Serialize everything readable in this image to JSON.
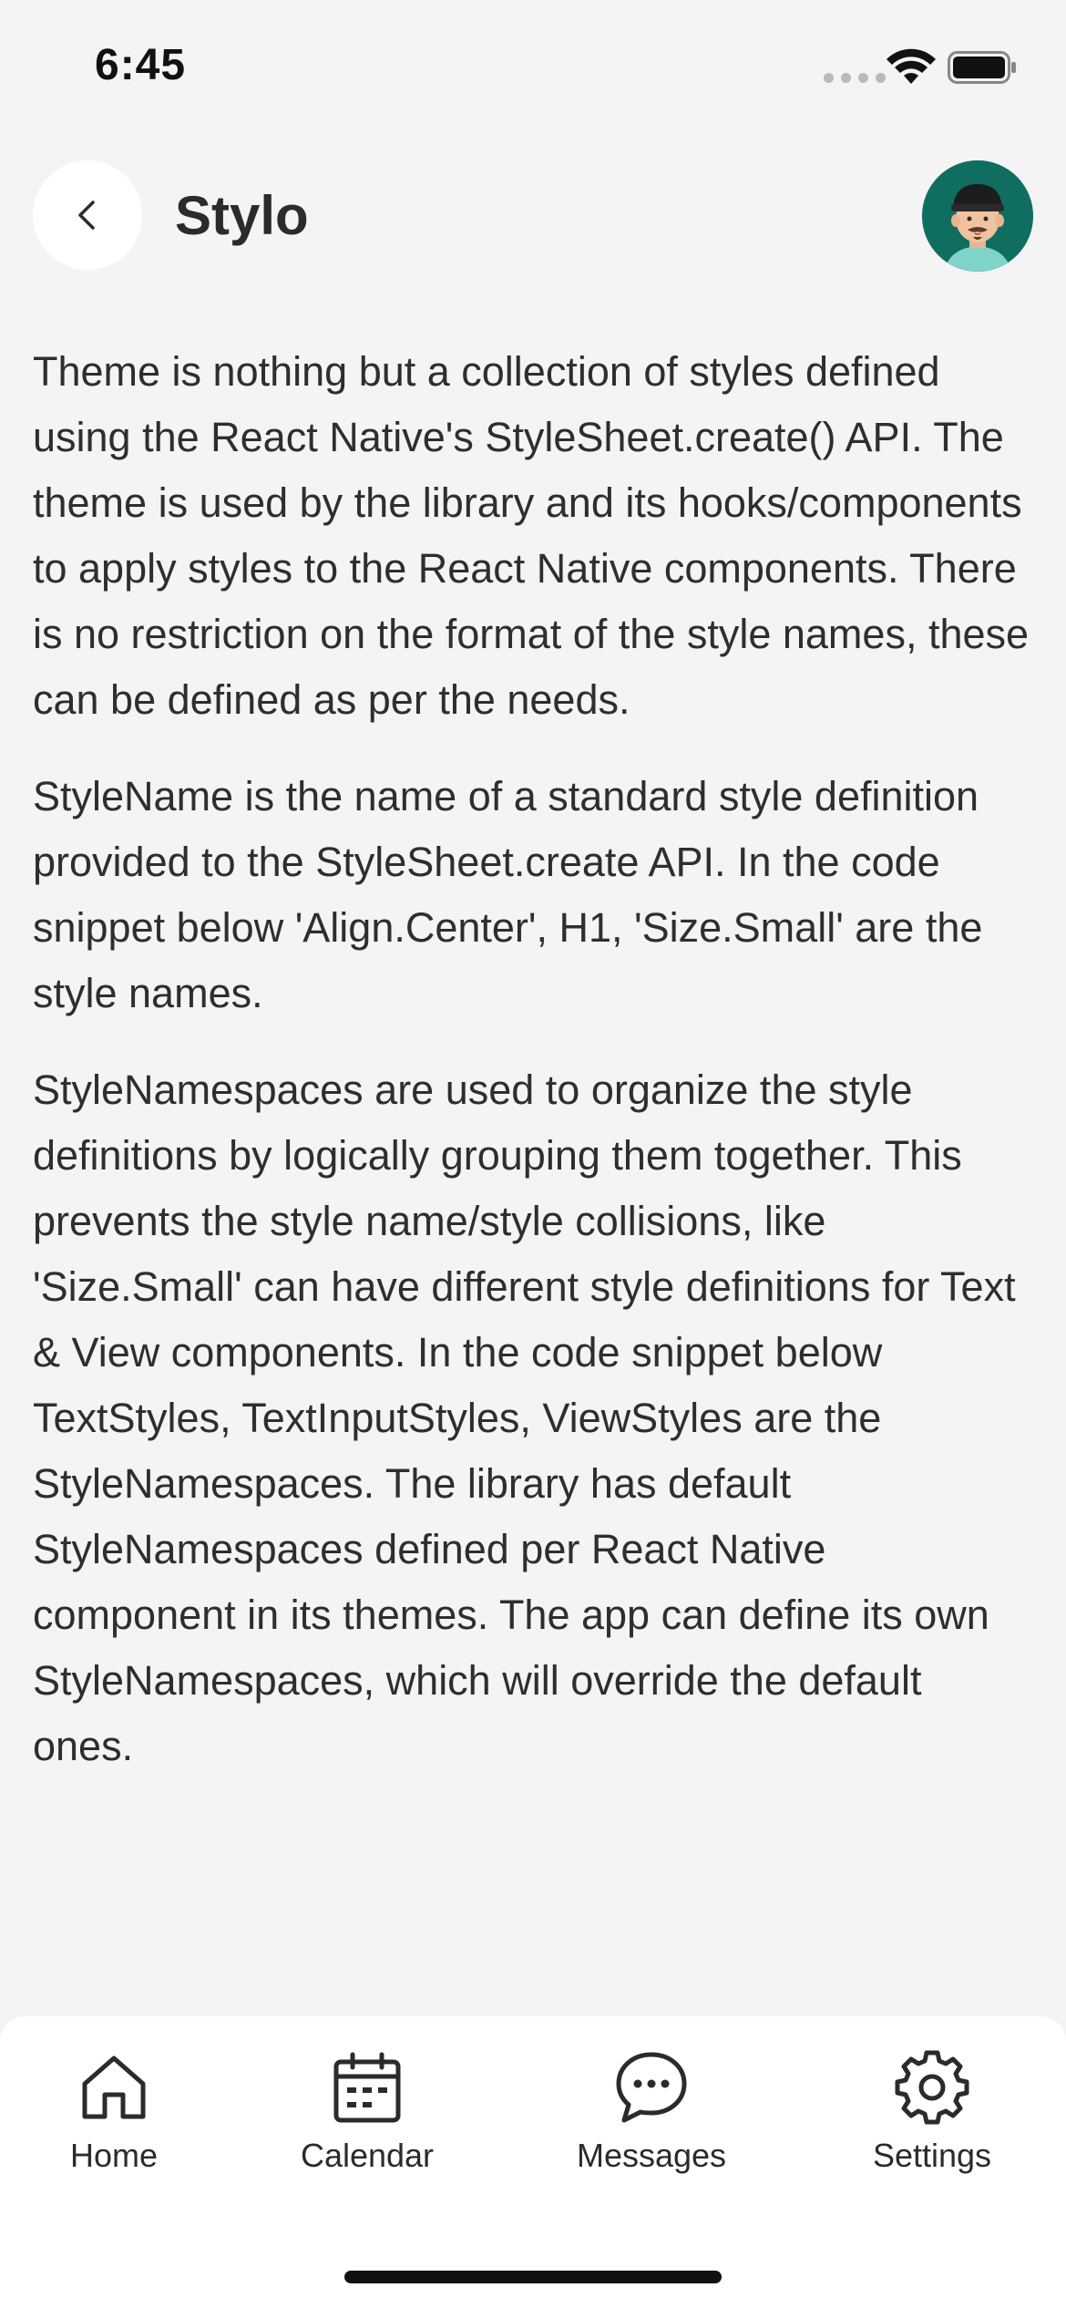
{
  "status_bar": {
    "time": "6:45"
  },
  "header": {
    "title": "Stylo",
    "back_icon": "chevron-left-icon",
    "avatar_icon": "user-avatar"
  },
  "content": {
    "paragraphs": [
      "Theme is nothing but a collection of styles defined using the React Native's StyleSheet.create() API. The theme is used by the library and its hooks/components to apply styles to the React Native components. There is no restriction on the format of the style names, these can be defined as per the needs.",
      "StyleName is the name of a standard style definition provided to the StyleSheet.create API. In the code snippet below 'Align.Center', H1, 'Size.Small' are the style names.",
      "StyleNamespaces are used to organize the style definitions by logically grouping them together. This prevents the style name/style collisions, like 'Size.Small' can have different style definitions for Text & View components. In the code snippet below TextStyles, TextInputStyles, ViewStyles are the StyleNamespaces. The library has default StyleNamespaces defined per React Native component in its themes. The app can define its own StyleNamespaces, which will override the default ones."
    ]
  },
  "tab_bar": {
    "items": [
      {
        "label": "Home",
        "icon": "home-icon"
      },
      {
        "label": "Calendar",
        "icon": "calendar-icon"
      },
      {
        "label": "Messages",
        "icon": "chat-bubble-icon"
      },
      {
        "label": "Settings",
        "icon": "gear-icon"
      }
    ]
  },
  "colors": {
    "background": "#f4f4f5",
    "surface": "#ffffff",
    "text": "#2b2b2b",
    "avatar_bg": "#0f6e5f"
  }
}
